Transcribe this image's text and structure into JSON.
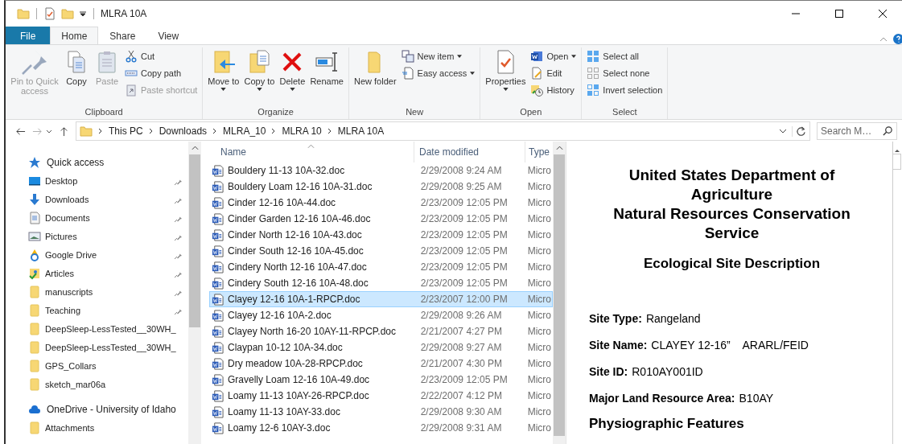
{
  "window": {
    "title": "MLRA 10A"
  },
  "tabs": [
    {
      "label": "File",
      "kind": "file",
      "selected": false
    },
    {
      "label": "Home",
      "kind": "tab",
      "selected": true
    },
    {
      "label": "Share",
      "kind": "tab",
      "selected": false
    },
    {
      "label": "View",
      "kind": "tab",
      "selected": false
    }
  ],
  "ribbon": {
    "groups": [
      {
        "label": "Clipboard",
        "large": [
          {
            "label": "Pin to Quick access",
            "disabled": true,
            "dropdown": false
          },
          {
            "label": "Copy",
            "disabled": false,
            "dropdown": false
          },
          {
            "label": "Paste",
            "disabled": true,
            "dropdown": false
          }
        ],
        "small": [
          {
            "label": "Cut",
            "disabled": false,
            "dropdown": false
          },
          {
            "label": "Copy path",
            "disabled": false,
            "dropdown": false
          },
          {
            "label": "Paste shortcut",
            "disabled": true,
            "dropdown": false
          }
        ]
      },
      {
        "label": "Organize",
        "large": [
          {
            "label": "Move to",
            "disabled": false,
            "dropdown": true
          },
          {
            "label": "Copy to",
            "disabled": false,
            "dropdown": true
          },
          {
            "label": "Delete",
            "disabled": false,
            "dropdown": true
          },
          {
            "label": "Rename",
            "disabled": false,
            "dropdown": false
          }
        ]
      },
      {
        "label": "New",
        "large": [
          {
            "label": "New folder",
            "disabled": false,
            "dropdown": false
          }
        ],
        "small": [
          {
            "label": "New item",
            "disabled": false,
            "dropdown": true
          },
          {
            "label": "Easy access",
            "disabled": false,
            "dropdown": true
          }
        ]
      },
      {
        "label": "Open",
        "large": [
          {
            "label": "Properties",
            "disabled": false,
            "dropdown": true
          }
        ],
        "small": [
          {
            "label": "Open",
            "disabled": false,
            "dropdown": true
          },
          {
            "label": "Edit",
            "disabled": false,
            "dropdown": false
          },
          {
            "label": "History",
            "disabled": false,
            "dropdown": false
          }
        ]
      },
      {
        "label": "Select",
        "small": [
          {
            "label": "Select all",
            "disabled": false,
            "dropdown": false
          },
          {
            "label": "Select none",
            "disabled": false,
            "dropdown": false
          },
          {
            "label": "Invert selection",
            "disabled": false,
            "dropdown": false
          }
        ]
      }
    ]
  },
  "address": {
    "path": [
      "This PC",
      "Downloads",
      "MLRA_10",
      "MLRA 10",
      "MLRA 10A"
    ],
    "search": {
      "placeholder": "Search M…"
    }
  },
  "nav": [
    {
      "label": "Quick access",
      "children": [
        {
          "label": "Desktop",
          "pinned": true
        },
        {
          "label": "Downloads",
          "pinned": true
        },
        {
          "label": "Documents",
          "pinned": true
        },
        {
          "label": "Pictures",
          "pinned": true
        },
        {
          "label": "Google Drive",
          "pinned": true
        },
        {
          "label": "Articles",
          "pinned": true
        },
        {
          "label": "manuscripts",
          "pinned": true
        },
        {
          "label": "Teaching",
          "pinned": true
        },
        {
          "label": "DeepSleep-LessTested__30WH_",
          "pinned": false
        },
        {
          "label": "DeepSleep-LessTested__30WH_",
          "pinned": false
        },
        {
          "label": "GPS_Collars",
          "pinned": false
        },
        {
          "label": "sketch_mar06a",
          "pinned": false
        }
      ]
    },
    {
      "label": "OneDrive - University of Idaho",
      "children": [
        {
          "label": "Attachments",
          "pinned": false
        }
      ]
    }
  ],
  "table": {
    "columns": [
      "Name",
      "Date modified",
      "Type"
    ],
    "rows": [
      {
        "name": "Bouldery 11-13 10A-32.doc",
        "date": "2/29/2008 9:24 AM",
        "type": "Micro",
        "selected": false
      },
      {
        "name": "Bouldery Loam 12-16 10A-31.doc",
        "date": "2/29/2008 9:25 AM",
        "type": "Micro",
        "selected": false
      },
      {
        "name": "Cinder 12-16 10A-44.doc",
        "date": "2/23/2009 12:05 PM",
        "type": "Micro",
        "selected": false
      },
      {
        "name": "Cinder Garden 12-16 10A-46.doc",
        "date": "2/23/2009 12:05 PM",
        "type": "Micro",
        "selected": false
      },
      {
        "name": "Cinder North 12-16 10A-43.doc",
        "date": "2/23/2009 12:05 PM",
        "type": "Micro",
        "selected": false
      },
      {
        "name": "Cinder South 12-16 10A-45.doc",
        "date": "2/23/2009 12:05 PM",
        "type": "Micro",
        "selected": false
      },
      {
        "name": "Cindery North 12-16 10A-47.doc",
        "date": "2/23/2009 12:05 PM",
        "type": "Micro",
        "selected": false
      },
      {
        "name": "Cindery South 12-16 10A-48.doc",
        "date": "2/23/2009 12:05 PM",
        "type": "Micro",
        "selected": false
      },
      {
        "name": "Clayey 12-16 10A-1-RPCP.doc",
        "date": "2/23/2007 12:00 PM",
        "type": "Micro",
        "selected": true
      },
      {
        "name": "Clayey 12-16 10A-2.doc",
        "date": "2/29/2008 9:26 AM",
        "type": "Micro",
        "selected": false
      },
      {
        "name": "Clayey North 16-20 10AY-11-RPCP.doc",
        "date": "2/21/2007 4:27 PM",
        "type": "Micro",
        "selected": false
      },
      {
        "name": "Claypan 10-12 10A-34.doc",
        "date": "2/29/2008 9:27 AM",
        "type": "Micro",
        "selected": false
      },
      {
        "name": "Dry meadow 10A-28-RPCP.doc",
        "date": "2/21/2007 4:30 PM",
        "type": "Micro",
        "selected": false
      },
      {
        "name": "Gravelly Loam 12-16 10A-49.doc",
        "date": "2/23/2009 12:05 PM",
        "type": "Micro",
        "selected": false
      },
      {
        "name": "Loamy 11-13 10AY-26-RPCP.doc",
        "date": "2/22/2007 4:12 PM",
        "type": "Micro",
        "selected": false
      },
      {
        "name": "Loamy 11-13 10AY-33.doc",
        "date": "2/29/2008 9:30 AM",
        "type": "Micro",
        "selected": false
      },
      {
        "name": "Loamy 12-6 10AY-3.doc",
        "date": "2/29/2008 9:31 AM",
        "type": "Micro",
        "selected": false
      }
    ]
  },
  "preview": {
    "heading": [
      "United States Department of Agriculture",
      "Natural Resources Conservation Service"
    ],
    "subtitle": "Ecological Site Description",
    "fields": [
      {
        "label": "Site Type:",
        "value": "Rangeland"
      },
      {
        "label": "Site Name:",
        "value": "CLAYEY 12-16”    ARARL/FEID"
      },
      {
        "label": "Site ID:",
        "value": "R010AY001ID"
      },
      {
        "label": "Major Land Resource Area:",
        "value": "B10AY"
      }
    ],
    "section": "Physiographic Features"
  }
}
